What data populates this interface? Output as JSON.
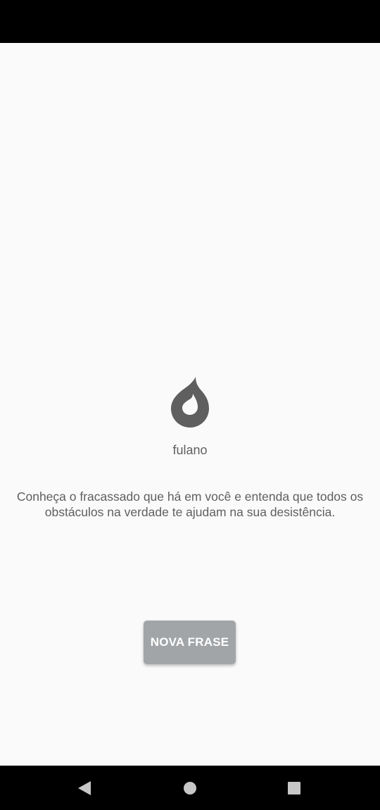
{
  "screen": {
    "author": "fulano",
    "quote": "Conheça o fracassado que há em você e entenda que todos os obstáculos na verdade te ajudam na sua desistência.",
    "button_label": "NOVA FRASE",
    "icon": "flame-icon"
  },
  "navigation": {
    "back_icon": "back-triangle-icon",
    "home_icon": "home-circle-icon",
    "recents_icon": "recents-square-icon"
  },
  "colors": {
    "background": "#fafafa",
    "text": "#5f5f5f",
    "icon": "#5f5f5f",
    "button": "#a2a5a8",
    "button_text": "#ffffff",
    "system_bars": "#000000"
  }
}
